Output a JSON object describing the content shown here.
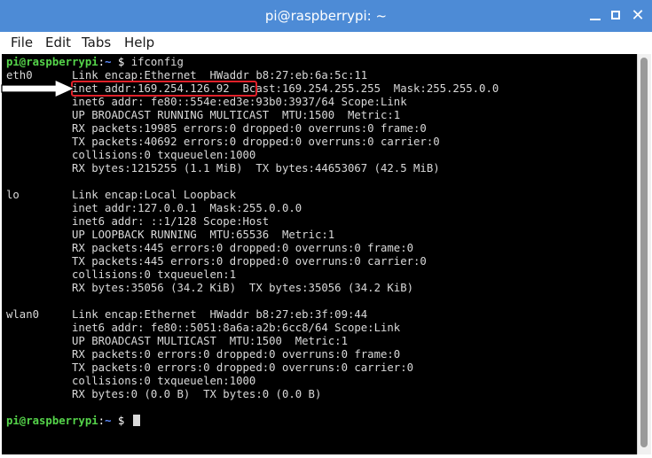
{
  "window": {
    "title": "pi@raspberrypi: ~",
    "controls": {
      "minimize_icon": "minimize-icon",
      "maximize_icon": "maximize-icon",
      "close_icon": "close-icon"
    },
    "accent_color": "#4d8bd6"
  },
  "menu": {
    "items": [
      "File",
      "Edit",
      "Tabs",
      "Help"
    ]
  },
  "terminal": {
    "prompt_user": "pi@raspberrypi",
    "prompt_sep": ":",
    "prompt_dir": "~",
    "prompt_symbol": " $ ",
    "command": "ifconfig",
    "output": [
      "eth0      Link encap:Ethernet  HWaddr b8:27:eb:6a:5c:11",
      "          inet addr:169.254.126.92  Bcast:169.254.255.255  Mask:255.255.0.0",
      "          inet6 addr: fe80::554e:ed3e:93b0:3937/64 Scope:Link",
      "          UP BROADCAST RUNNING MULTICAST  MTU:1500  Metric:1",
      "          RX packets:19985 errors:0 dropped:0 overruns:0 frame:0",
      "          TX packets:40692 errors:0 dropped:0 overruns:0 carrier:0",
      "          collisions:0 txqueuelen:1000",
      "          RX bytes:1215255 (1.1 MiB)  TX bytes:44653067 (42.5 MiB)",
      "",
      "lo        Link encap:Local Loopback",
      "          inet addr:127.0.0.1  Mask:255.0.0.0",
      "          inet6 addr: ::1/128 Scope:Host",
      "          UP LOOPBACK RUNNING  MTU:65536  Metric:1",
      "          RX packets:445 errors:0 dropped:0 overruns:0 frame:0",
      "          TX packets:445 errors:0 dropped:0 overruns:0 carrier:0",
      "          collisions:0 txqueuelen:1",
      "          RX bytes:35056 (34.2 KiB)  TX bytes:35056 (34.2 KiB)",
      "",
      "wlan0     Link encap:Ethernet  HWaddr b8:27:eb:3f:09:44",
      "          inet6 addr: fe80::5051:8a6a:a2b:6cc8/64 Scope:Link",
      "          UP BROADCAST MULTICAST  MTU:1500  Metric:1",
      "          RX packets:0 errors:0 dropped:0 overruns:0 frame:0",
      "          TX packets:0 errors:0 dropped:0 overruns:0 carrier:0",
      "          collisions:0 txqueuelen:1000",
      "          RX bytes:0 (0.0 B)  TX bytes:0 (0.0 B)",
      ""
    ],
    "annotation_color": "#e0212a"
  }
}
